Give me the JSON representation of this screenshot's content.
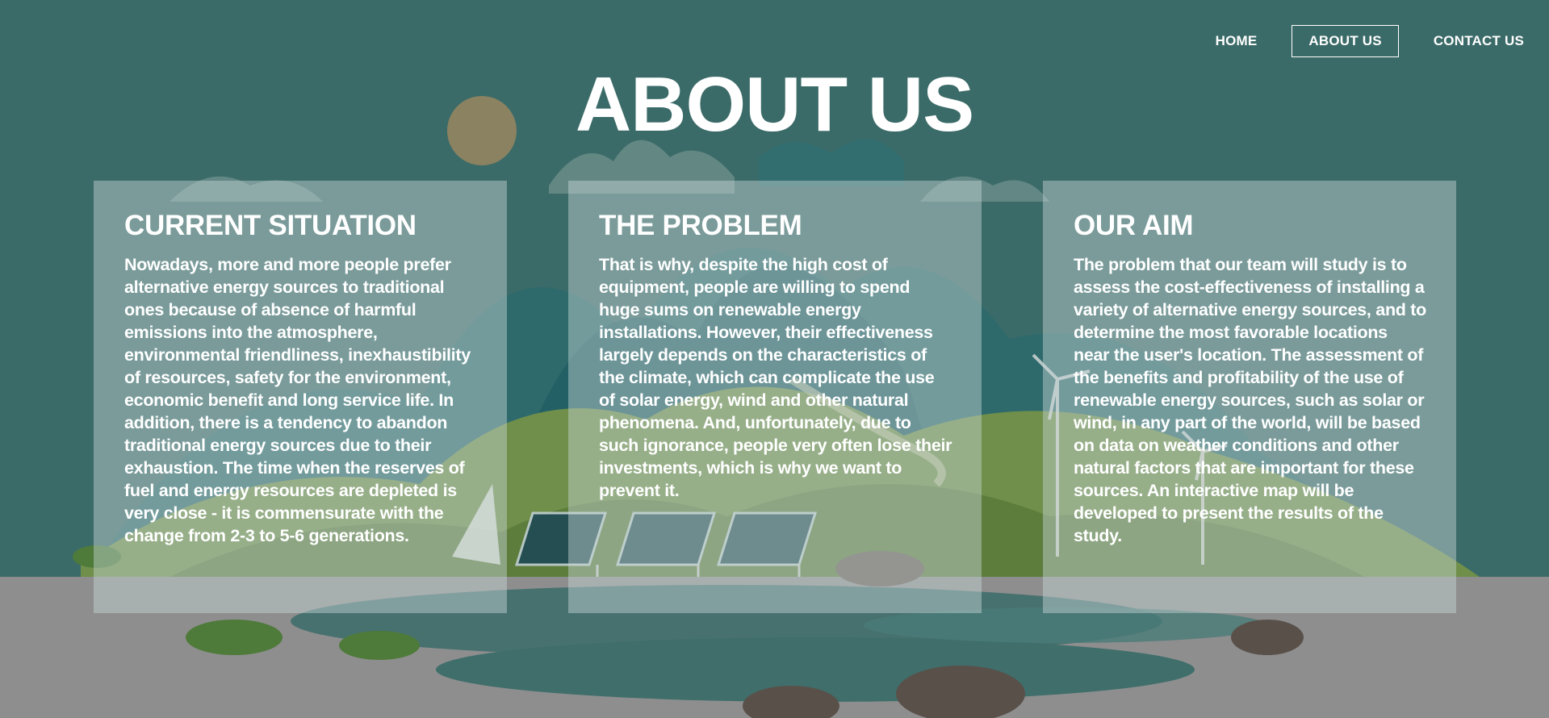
{
  "nav": {
    "items": [
      {
        "label": "HOME",
        "active": false
      },
      {
        "label": "ABOUT US",
        "active": true
      },
      {
        "label": "CONTACT US",
        "active": false
      }
    ]
  },
  "page": {
    "title": "ABOUT US"
  },
  "cards": [
    {
      "title": "CURRENT SITUATION",
      "text": "Nowadays, more and more people prefer alternative energy sources to traditional ones because of absence of harmful emissions into the atmosphere, environmental friendliness, inexhaustibility of resources, safety for the environment, economic benefit and long service life. In addition, there is a tendency to abandon traditional energy sources due to their exhaustion. The time when the reserves of fuel and energy resources are depleted is very close - it is commensurate with the change from 2-3 to 5-6 generations."
    },
    {
      "title": "THE PROBLEM",
      "text": "That is why, despite the high cost of equipment, people are willing to spend huge sums on renewable energy installations. However, their effectiveness largely depends on the characteristics of the climate, which can complicate the use of solar energy, wind and other natural phenomena. And, unfortunately, due to such ignorance, people very often lose their investments, which is why we want to prevent it."
    },
    {
      "title": "OUR AIM",
      "text": "The problem that our team will study is to assess the cost-effectiveness of installing a variety of alternative energy sources, and to determine the most favorable locations near the user's location. The assessment of the benefits and profitability of the use of renewable energy sources, such as solar or wind, in any part of the world, will be based on data on weather conditions and other natural factors that are important for these sources. An interactive map will be developed to present the results of the study."
    }
  ],
  "colors": {
    "sky": "#3b6b68",
    "ground": "#8e8e8e",
    "hill": "#6f8f4a",
    "text": "#ffffff"
  }
}
